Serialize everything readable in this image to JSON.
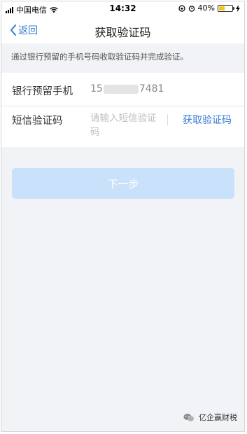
{
  "status_bar": {
    "carrier": "中国电信",
    "time": "14:32",
    "battery_percent": "40%",
    "battery_color": "#f5c518"
  },
  "nav": {
    "back_label": "返回",
    "title": "获取验证码"
  },
  "notice": {
    "text": "通过银行预留的手机号码收取验证码并完成验证。"
  },
  "form": {
    "phone_label": "银行预留手机",
    "phone_prefix": "15",
    "phone_suffix": "7481",
    "code_label": "短信验证码",
    "code_placeholder": "请输入短信验证码",
    "code_value": "",
    "get_code_label": "获取验证码"
  },
  "next_button": {
    "label": "下一步",
    "enabled": false
  },
  "watermark": {
    "text": "亿企赢财税"
  },
  "colors": {
    "accent": "#3a7bd5",
    "button_disabled_bg": "#c9e1fb",
    "background_gray": "#f2f3f6"
  }
}
